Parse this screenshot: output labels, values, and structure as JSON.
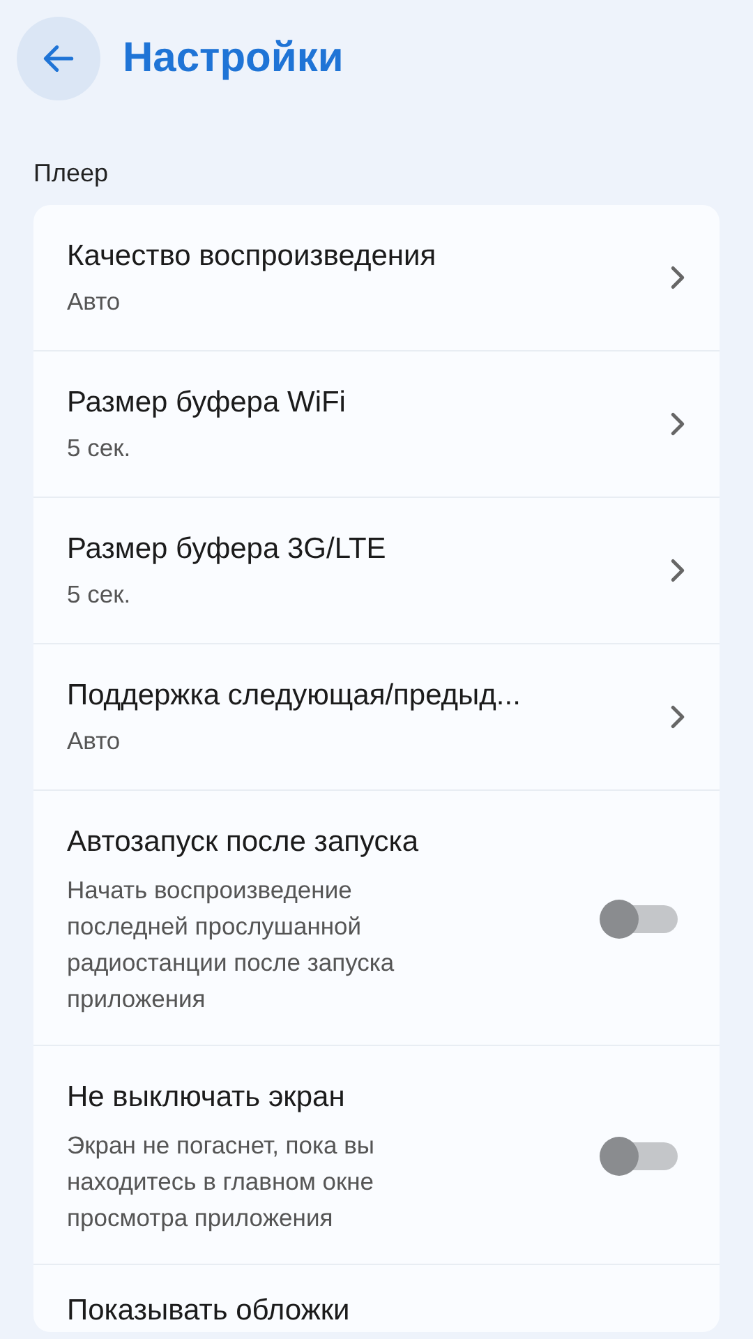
{
  "header": {
    "title": "Настройки"
  },
  "sections": [
    {
      "title": "Плеер",
      "items": [
        {
          "kind": "nav",
          "title": "Качество воспроизведения",
          "subtitle": "Авто"
        },
        {
          "kind": "nav",
          "title": "Размер буфера WiFi",
          "subtitle": "5 сек."
        },
        {
          "kind": "nav",
          "title": "Размер буфера 3G/LTE",
          "subtitle": "5 сек."
        },
        {
          "kind": "nav",
          "title": "Поддержка следующая/предыд...",
          "subtitle": "Авто"
        },
        {
          "kind": "toggle",
          "title": "Автозапуск после запуска",
          "subtitle": "Начать воспроизведение последней прослушанной радиостанции после запуска приложения",
          "on": false
        },
        {
          "kind": "toggle",
          "title": "Не выключать экран",
          "subtitle": "Экран не погаснет, пока вы находитесь в главном окне просмотра приложения",
          "on": false
        },
        {
          "kind": "plain",
          "title": "Показывать обложки"
        }
      ]
    }
  ]
}
